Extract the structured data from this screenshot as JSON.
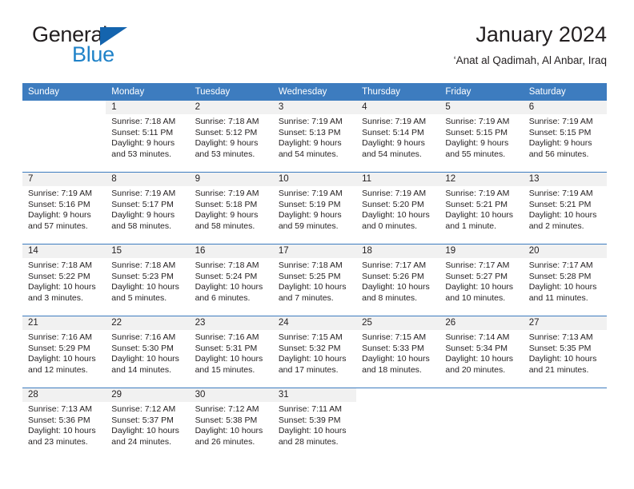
{
  "brand": {
    "name_part1": "General",
    "name_part2": "Blue",
    "triangle_color": "#1464ae",
    "blue_text_color": "#1f82c8"
  },
  "header": {
    "title": "January 2024",
    "location": "‘Anat al Qadimah, Al Anbar, Iraq"
  },
  "theme": {
    "header_row_bg": "#3d7cbf",
    "daynum_bg": "#f1f1f1",
    "text_color": "#231f20"
  },
  "weekdays": [
    "Sunday",
    "Monday",
    "Tuesday",
    "Wednesday",
    "Thursday",
    "Friday",
    "Saturday"
  ],
  "weeks": [
    [
      {
        "day": "",
        "lines": []
      },
      {
        "day": "1",
        "lines": [
          "Sunrise: 7:18 AM",
          "Sunset: 5:11 PM",
          "Daylight: 9 hours",
          "and 53 minutes."
        ]
      },
      {
        "day": "2",
        "lines": [
          "Sunrise: 7:18 AM",
          "Sunset: 5:12 PM",
          "Daylight: 9 hours",
          "and 53 minutes."
        ]
      },
      {
        "day": "3",
        "lines": [
          "Sunrise: 7:19 AM",
          "Sunset: 5:13 PM",
          "Daylight: 9 hours",
          "and 54 minutes."
        ]
      },
      {
        "day": "4",
        "lines": [
          "Sunrise: 7:19 AM",
          "Sunset: 5:14 PM",
          "Daylight: 9 hours",
          "and 54 minutes."
        ]
      },
      {
        "day": "5",
        "lines": [
          "Sunrise: 7:19 AM",
          "Sunset: 5:15 PM",
          "Daylight: 9 hours",
          "and 55 minutes."
        ]
      },
      {
        "day": "6",
        "lines": [
          "Sunrise: 7:19 AM",
          "Sunset: 5:15 PM",
          "Daylight: 9 hours",
          "and 56 minutes."
        ]
      }
    ],
    [
      {
        "day": "7",
        "lines": [
          "Sunrise: 7:19 AM",
          "Sunset: 5:16 PM",
          "Daylight: 9 hours",
          "and 57 minutes."
        ]
      },
      {
        "day": "8",
        "lines": [
          "Sunrise: 7:19 AM",
          "Sunset: 5:17 PM",
          "Daylight: 9 hours",
          "and 58 minutes."
        ]
      },
      {
        "day": "9",
        "lines": [
          "Sunrise: 7:19 AM",
          "Sunset: 5:18 PM",
          "Daylight: 9 hours",
          "and 58 minutes."
        ]
      },
      {
        "day": "10",
        "lines": [
          "Sunrise: 7:19 AM",
          "Sunset: 5:19 PM",
          "Daylight: 9 hours",
          "and 59 minutes."
        ]
      },
      {
        "day": "11",
        "lines": [
          "Sunrise: 7:19 AM",
          "Sunset: 5:20 PM",
          "Daylight: 10 hours",
          "and 0 minutes."
        ]
      },
      {
        "day": "12",
        "lines": [
          "Sunrise: 7:19 AM",
          "Sunset: 5:21 PM",
          "Daylight: 10 hours",
          "and 1 minute."
        ]
      },
      {
        "day": "13",
        "lines": [
          "Sunrise: 7:19 AM",
          "Sunset: 5:21 PM",
          "Daylight: 10 hours",
          "and 2 minutes."
        ]
      }
    ],
    [
      {
        "day": "14",
        "lines": [
          "Sunrise: 7:18 AM",
          "Sunset: 5:22 PM",
          "Daylight: 10 hours",
          "and 3 minutes."
        ]
      },
      {
        "day": "15",
        "lines": [
          "Sunrise: 7:18 AM",
          "Sunset: 5:23 PM",
          "Daylight: 10 hours",
          "and 5 minutes."
        ]
      },
      {
        "day": "16",
        "lines": [
          "Sunrise: 7:18 AM",
          "Sunset: 5:24 PM",
          "Daylight: 10 hours",
          "and 6 minutes."
        ]
      },
      {
        "day": "17",
        "lines": [
          "Sunrise: 7:18 AM",
          "Sunset: 5:25 PM",
          "Daylight: 10 hours",
          "and 7 minutes."
        ]
      },
      {
        "day": "18",
        "lines": [
          "Sunrise: 7:17 AM",
          "Sunset: 5:26 PM",
          "Daylight: 10 hours",
          "and 8 minutes."
        ]
      },
      {
        "day": "19",
        "lines": [
          "Sunrise: 7:17 AM",
          "Sunset: 5:27 PM",
          "Daylight: 10 hours",
          "and 10 minutes."
        ]
      },
      {
        "day": "20",
        "lines": [
          "Sunrise: 7:17 AM",
          "Sunset: 5:28 PM",
          "Daylight: 10 hours",
          "and 11 minutes."
        ]
      }
    ],
    [
      {
        "day": "21",
        "lines": [
          "Sunrise: 7:16 AM",
          "Sunset: 5:29 PM",
          "Daylight: 10 hours",
          "and 12 minutes."
        ]
      },
      {
        "day": "22",
        "lines": [
          "Sunrise: 7:16 AM",
          "Sunset: 5:30 PM",
          "Daylight: 10 hours",
          "and 14 minutes."
        ]
      },
      {
        "day": "23",
        "lines": [
          "Sunrise: 7:16 AM",
          "Sunset: 5:31 PM",
          "Daylight: 10 hours",
          "and 15 minutes."
        ]
      },
      {
        "day": "24",
        "lines": [
          "Sunrise: 7:15 AM",
          "Sunset: 5:32 PM",
          "Daylight: 10 hours",
          "and 17 minutes."
        ]
      },
      {
        "day": "25",
        "lines": [
          "Sunrise: 7:15 AM",
          "Sunset: 5:33 PM",
          "Daylight: 10 hours",
          "and 18 minutes."
        ]
      },
      {
        "day": "26",
        "lines": [
          "Sunrise: 7:14 AM",
          "Sunset: 5:34 PM",
          "Daylight: 10 hours",
          "and 20 minutes."
        ]
      },
      {
        "day": "27",
        "lines": [
          "Sunrise: 7:13 AM",
          "Sunset: 5:35 PM",
          "Daylight: 10 hours",
          "and 21 minutes."
        ]
      }
    ],
    [
      {
        "day": "28",
        "lines": [
          "Sunrise: 7:13 AM",
          "Sunset: 5:36 PM",
          "Daylight: 10 hours",
          "and 23 minutes."
        ]
      },
      {
        "day": "29",
        "lines": [
          "Sunrise: 7:12 AM",
          "Sunset: 5:37 PM",
          "Daylight: 10 hours",
          "and 24 minutes."
        ]
      },
      {
        "day": "30",
        "lines": [
          "Sunrise: 7:12 AM",
          "Sunset: 5:38 PM",
          "Daylight: 10 hours",
          "and 26 minutes."
        ]
      },
      {
        "day": "31",
        "lines": [
          "Sunrise: 7:11 AM",
          "Sunset: 5:39 PM",
          "Daylight: 10 hours",
          "and 28 minutes."
        ]
      },
      {
        "day": "",
        "lines": []
      },
      {
        "day": "",
        "lines": []
      },
      {
        "day": "",
        "lines": []
      }
    ]
  ]
}
